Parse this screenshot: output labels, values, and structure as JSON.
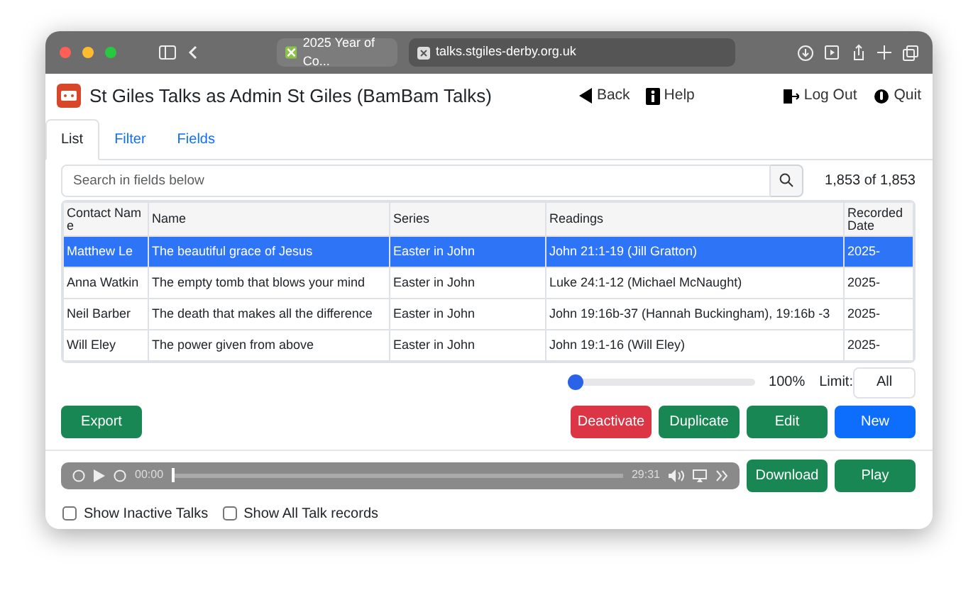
{
  "browser": {
    "tabs": [
      {
        "label": "2025 Year of Co...",
        "selected": false
      },
      {
        "label": "talks.stgiles-derby.org.uk",
        "selected": true
      }
    ]
  },
  "app": {
    "title": "St Giles Talks as Admin St Giles (BamBam Talks)",
    "nav": [
      {
        "label": "Back",
        "kind": "back"
      },
      {
        "label": "Help",
        "kind": "help"
      },
      {
        "label": "Log Out",
        "kind": "logout"
      },
      {
        "label": "Quit",
        "kind": "quit"
      }
    ]
  },
  "tabs": [
    {
      "label": "List",
      "selected": true
    },
    {
      "label": "Filter",
      "selected": false
    },
    {
      "label": "Fields",
      "selected": false
    }
  ],
  "search": {
    "placeholder": "Search in fields below"
  },
  "count": "1,853 of 1,853",
  "table": {
    "columns": [
      "Contact Name",
      "Name",
      "Series",
      "Readings",
      "Recorded Date"
    ],
    "rows": [
      {
        "selected": true,
        "cells": [
          "Matthew Le",
          "The beautiful grace of Jesus",
          "Easter in John",
          "John 21:1-19 (Jill Gratton)",
          "2025-"
        ]
      },
      {
        "selected": false,
        "cells": [
          "Anna Watkin",
          "The empty tomb that blows your mind",
          "Easter in John",
          "Luke 24:1-12 (Michael McNaught)",
          "2025-"
        ]
      },
      {
        "selected": false,
        "cells": [
          "Neil Barber",
          "The death that makes all the difference",
          "Easter in John",
          "John 19:16b-37 (Hannah Buckingham), 19:16b -3",
          "2025-"
        ]
      },
      {
        "selected": false,
        "cells": [
          "Will Eley",
          "The power given from above",
          "Easter in John",
          "John 19:1-16 (Will Eley)",
          "2025-"
        ]
      }
    ]
  },
  "zoom": {
    "level": 0,
    "reading": "100%"
  },
  "limit": {
    "label": "Limit:",
    "value": "All"
  },
  "actions": [
    {
      "label": "Export",
      "kind": "success"
    },
    {
      "label": "Deactivate",
      "kind": "danger"
    },
    {
      "label": "Duplicate",
      "kind": "success"
    },
    {
      "label": "Edit",
      "kind": "success"
    },
    {
      "label": "New",
      "kind": "primary"
    }
  ],
  "player": {
    "elapsed": "00:00",
    "duration": "29:31",
    "level": 0
  },
  "player_buttons": [
    {
      "label": "Download",
      "kind": "success"
    },
    {
      "label": "Play",
      "kind": "success"
    }
  ],
  "options": [
    {
      "label": "Show Inactive Talks",
      "checked": false
    },
    {
      "label": "Show All Talk records",
      "checked": false
    }
  ]
}
